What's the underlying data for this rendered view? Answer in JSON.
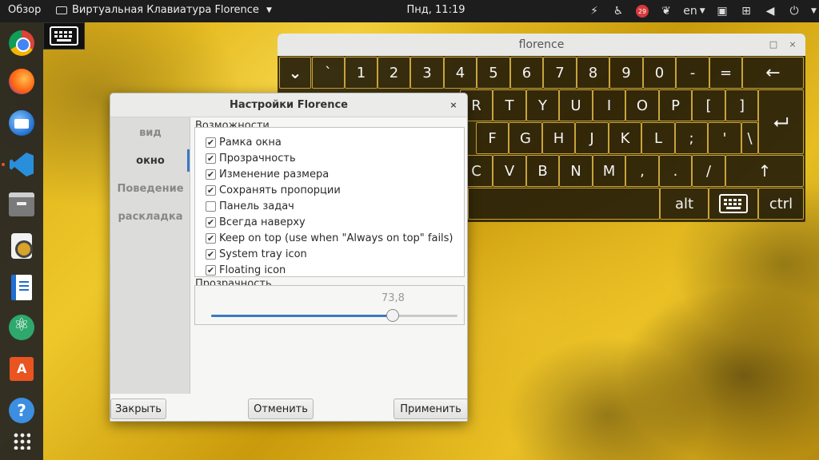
{
  "topbar": {
    "activities": "Обзор",
    "app_name": "Виртуальная Клавиатура Florence",
    "clock": "Пнд, 11:19",
    "badge_count": "29",
    "lang": "en"
  },
  "dock": {
    "items": [
      "chrome-icon",
      "firefox-icon",
      "thunderbird-icon",
      "vscode-icon",
      "files-icon",
      "rhythmbox-icon",
      "writer-icon",
      "atom-icon",
      "software-icon",
      "help-icon",
      "apps-grid-icon"
    ]
  },
  "keyboard": {
    "title": "florence",
    "row1": [
      "`",
      "1",
      "2",
      "3",
      "4",
      "5",
      "6",
      "7",
      "8",
      "9",
      "0",
      "-",
      "=",
      "←"
    ],
    "row2": [
      "R",
      "T",
      "Y",
      "U",
      "I",
      "O",
      "P",
      "[",
      "]",
      "⮠"
    ],
    "row3": [
      "F",
      "G",
      "H",
      "J",
      "K",
      "L",
      ";",
      "'",
      "\\"
    ],
    "row4": [
      "C",
      "V",
      "B",
      "N",
      "M",
      ",",
      ".",
      "/",
      "↑"
    ],
    "row5": [
      "alt",
      "ctrl"
    ]
  },
  "dialog": {
    "title": "Настройки Florence",
    "sidebar": [
      "вид",
      "окно",
      "Поведение",
      "раскладка"
    ],
    "features_label": "Возможности",
    "options": [
      {
        "label": "Рамка окна",
        "checked": true
      },
      {
        "label": "Прозрачность",
        "checked": true
      },
      {
        "label": "Изменение размера",
        "checked": true
      },
      {
        "label": "Сохранять пропорции",
        "checked": true
      },
      {
        "label": "Панель задач",
        "checked": false
      },
      {
        "label": "Всегда наверху",
        "checked": true
      },
      {
        "label": "Keep on top (use when \"Always on top\" fails)",
        "checked": true
      },
      {
        "label": "System tray icon",
        "checked": true
      },
      {
        "label": "Floating icon",
        "checked": true
      }
    ],
    "transparency_label": "Прозрачность",
    "transparency_value": "73,8",
    "transparency_fraction": 0.738,
    "buttons": {
      "close": "Закрыть",
      "cancel": "Отменить",
      "apply": "Применить"
    }
  }
}
